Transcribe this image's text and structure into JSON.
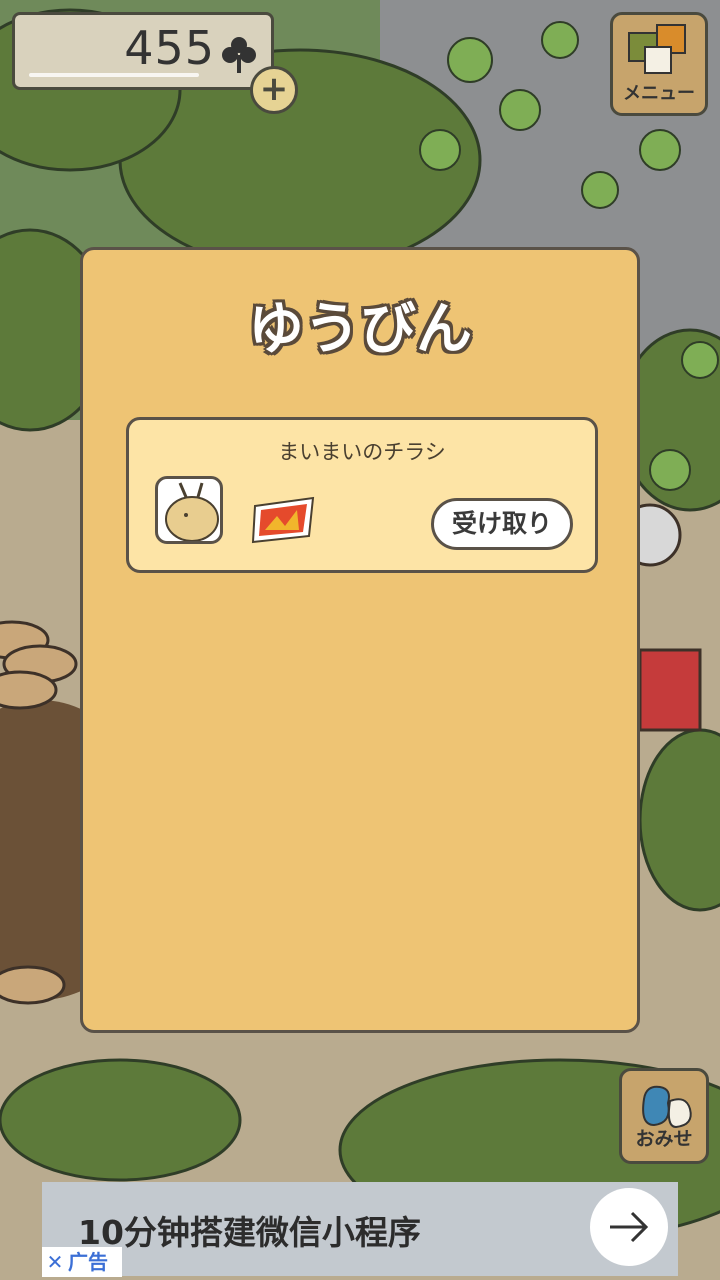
{
  "hud": {
    "clover_count": "455",
    "clover_icon": "clover-icon",
    "add_icon": "plus-icon"
  },
  "menu": {
    "label": "メニュー",
    "icon": "menu-icon"
  },
  "mailbox": {
    "title": "ゆうびん",
    "items": [
      {
        "subject": "まいまいのチラシ",
        "sender_icon": "snail-avatar-icon",
        "attachment_icon": "flyer-icon",
        "action_label": "受け取り"
      }
    ]
  },
  "shop": {
    "label": "おみせ",
    "icon": "shop-bag-icon"
  },
  "ad": {
    "text": "10分钟搭建微信小程序",
    "tag_label": "广告",
    "close_icon": "close-icon",
    "arrow_icon": "arrow-right-icon"
  }
}
